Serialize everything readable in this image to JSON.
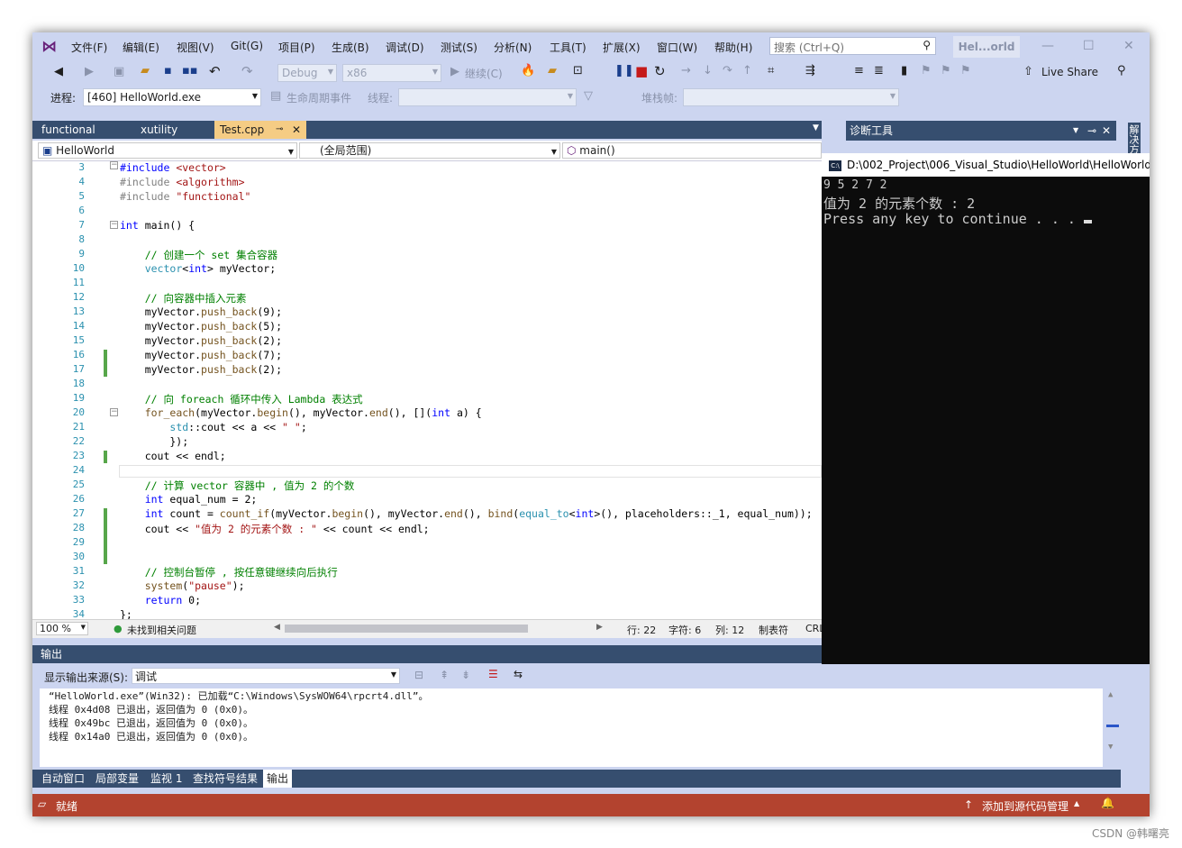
{
  "menu": {
    "items": [
      "文件(F)",
      "编辑(E)",
      "视图(V)",
      "Git(G)",
      "项目(P)",
      "生成(B)",
      "调试(D)",
      "测试(S)",
      "分析(N)",
      "工具(T)",
      "扩展(X)",
      "窗口(W)",
      "帮助(H)"
    ],
    "search_placeholder": "搜索 (Ctrl+Q)",
    "title": "Hel...orld"
  },
  "toolbar": {
    "config": "Debug",
    "platform": "x86",
    "continue_label": "继续(C)",
    "live_share": "Live Share"
  },
  "toolbar2": {
    "process_label": "进程:",
    "process_value": "[460] HelloWorld.exe",
    "lifecycle_label": "生命周期事件",
    "thread_label": "线程:",
    "stackframe_label": "堆栈帧:"
  },
  "tabs": [
    {
      "label": "functional",
      "active": false
    },
    {
      "label": "xutility",
      "active": false
    },
    {
      "label": "Test.cpp",
      "active": true
    }
  ],
  "nav": {
    "project": "HelloWorld",
    "scope": "(全局范围)",
    "member": "main()"
  },
  "editor": {
    "line_numbers": [
      "3",
      "4",
      "5",
      "6",
      "7",
      "8",
      "9",
      "10",
      "11",
      "12",
      "13",
      "14",
      "15",
      "16",
      "17",
      "18",
      "19",
      "20",
      "21",
      "22",
      "23",
      "24",
      "25",
      "26",
      "27",
      "28",
      "29",
      "30",
      "31",
      "32",
      "33",
      "34"
    ]
  },
  "editor_status": {
    "zoom": "100 %",
    "issues": "未找到相关问题",
    "line": "行: 22",
    "char": "字符: 6",
    "col": "列: 12",
    "tabs": "制表符",
    "eol": "CRL"
  },
  "diagnostics": {
    "title": "诊断工具",
    "side_label": "解决方"
  },
  "console": {
    "title": "D:\\002_Project\\006_Visual_Studio\\HelloWorld\\HelloWorld\\",
    "lines": [
      "9 5 2 7 2",
      "值为 2 的元素个数 : 2",
      "Press any key to continue . . . "
    ]
  },
  "output": {
    "header": "输出",
    "source_label": "显示输出来源(S):",
    "source_value": "调试",
    "lines": [
      "“HelloWorld.exe”(Win32): 已加载“C:\\Windows\\SysWOW64\\rpcrt4.dll”。",
      "线程 0x4d08 已退出，返回值为 0 (0x0)。",
      "线程 0x49bc 已退出，返回值为 0 (0x0)。",
      "线程 0x14a0 已退出，返回值为 0 (0x0)。"
    ]
  },
  "bottom_tabs": [
    "自动窗口",
    "局部变量",
    "监视 1",
    "查找符号结果",
    "输出"
  ],
  "statusbar": {
    "ready": "就绪",
    "source_control": "添加到源代码管理"
  },
  "watermark": "CSDN @韩曙亮"
}
